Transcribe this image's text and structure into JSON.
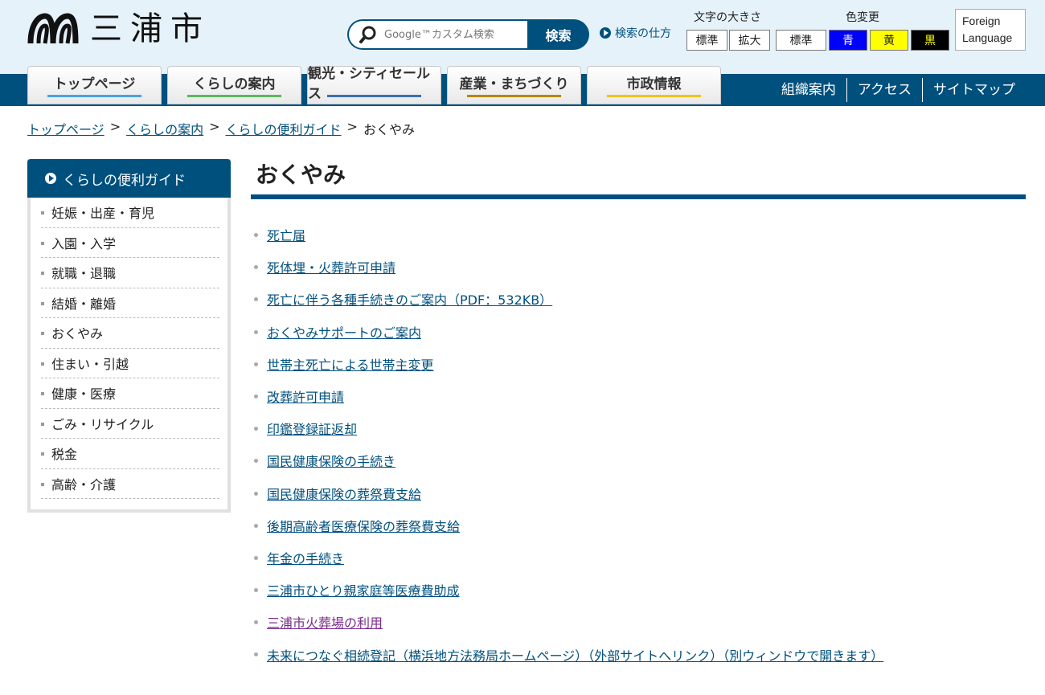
{
  "site": {
    "name": "三浦市"
  },
  "search": {
    "placeholder": "Google™カスタム検索",
    "button_label": "検索",
    "howto_label": "検索の仕方"
  },
  "font_size": {
    "label": "文字の大きさ",
    "options": [
      "標準",
      "拡大"
    ]
  },
  "color_change": {
    "label": "色変更",
    "options": [
      {
        "label": "標準",
        "bg": "#ffffff",
        "fg": "#222222"
      },
      {
        "label": "青",
        "bg": "#0000ff",
        "fg": "#ffffff"
      },
      {
        "label": "黄",
        "bg": "#ffff00",
        "fg": "#222222"
      },
      {
        "label": "黒",
        "bg": "#000000",
        "fg": "#ffff00"
      }
    ]
  },
  "foreign_language": {
    "label_line1": "Foreign",
    "label_line2": "Language"
  },
  "nav": {
    "tabs": [
      {
        "label": "トップページ",
        "accent": "#4aa3df"
      },
      {
        "label": "くらしの案内",
        "accent": "#5cb85c"
      },
      {
        "label": "観光・シティセールス",
        "accent": "#3a6fb5"
      },
      {
        "label": "産業・まちづくり",
        "accent": "#b8860b"
      },
      {
        "label": "市政情報",
        "accent": "#f0c419"
      }
    ],
    "util_links": [
      "組織案内",
      "アクセス",
      "サイトマップ"
    ]
  },
  "breadcrumb": {
    "items": [
      "トップページ",
      "くらしの案内",
      "くらしの便利ガイド"
    ],
    "current": "おくやみ",
    "separator": ">"
  },
  "sidebar": {
    "title": "くらしの便利ガイド",
    "items": [
      "妊娠・出産・育児",
      "入園・入学",
      "就職・退職",
      "結婚・離婚",
      "おくやみ",
      "住まい・引越",
      "健康・医療",
      "ごみ・リサイクル",
      "税金",
      "高齢・介護"
    ]
  },
  "main": {
    "title": "おくやみ",
    "links": [
      {
        "label": "死亡届",
        "visited": false
      },
      {
        "label": "死体埋・火葬許可申請",
        "visited": false
      },
      {
        "label": "死亡に伴う各種手続きのご案内（PDF：532KB）",
        "visited": false
      },
      {
        "label": "おくやみサポートのご案内",
        "visited": false
      },
      {
        "label": "世帯主死亡による世帯主変更",
        "visited": false
      },
      {
        "label": "改葬許可申請",
        "visited": false
      },
      {
        "label": "印鑑登録証返却",
        "visited": false
      },
      {
        "label": "国民健康保険の手続き",
        "visited": false
      },
      {
        "label": "国民健康保険の葬祭費支給",
        "visited": false
      },
      {
        "label": "後期高齢者医療保険の葬祭費支給",
        "visited": false
      },
      {
        "label": "年金の手続き",
        "visited": false
      },
      {
        "label": "三浦市ひとり親家庭等医療費助成",
        "visited": false
      },
      {
        "label": "三浦市火葬場の利用",
        "visited": true
      },
      {
        "label": "未来につなぐ相続登記（横浜地方法務局ホームページ）（外部サイトへリンク）（別ウィンドウで開きます）",
        "visited": false
      }
    ]
  },
  "colors": {
    "brand": "#00507e",
    "header_bg": "#e6f2fa",
    "visited_link": "#7a2b8a"
  }
}
